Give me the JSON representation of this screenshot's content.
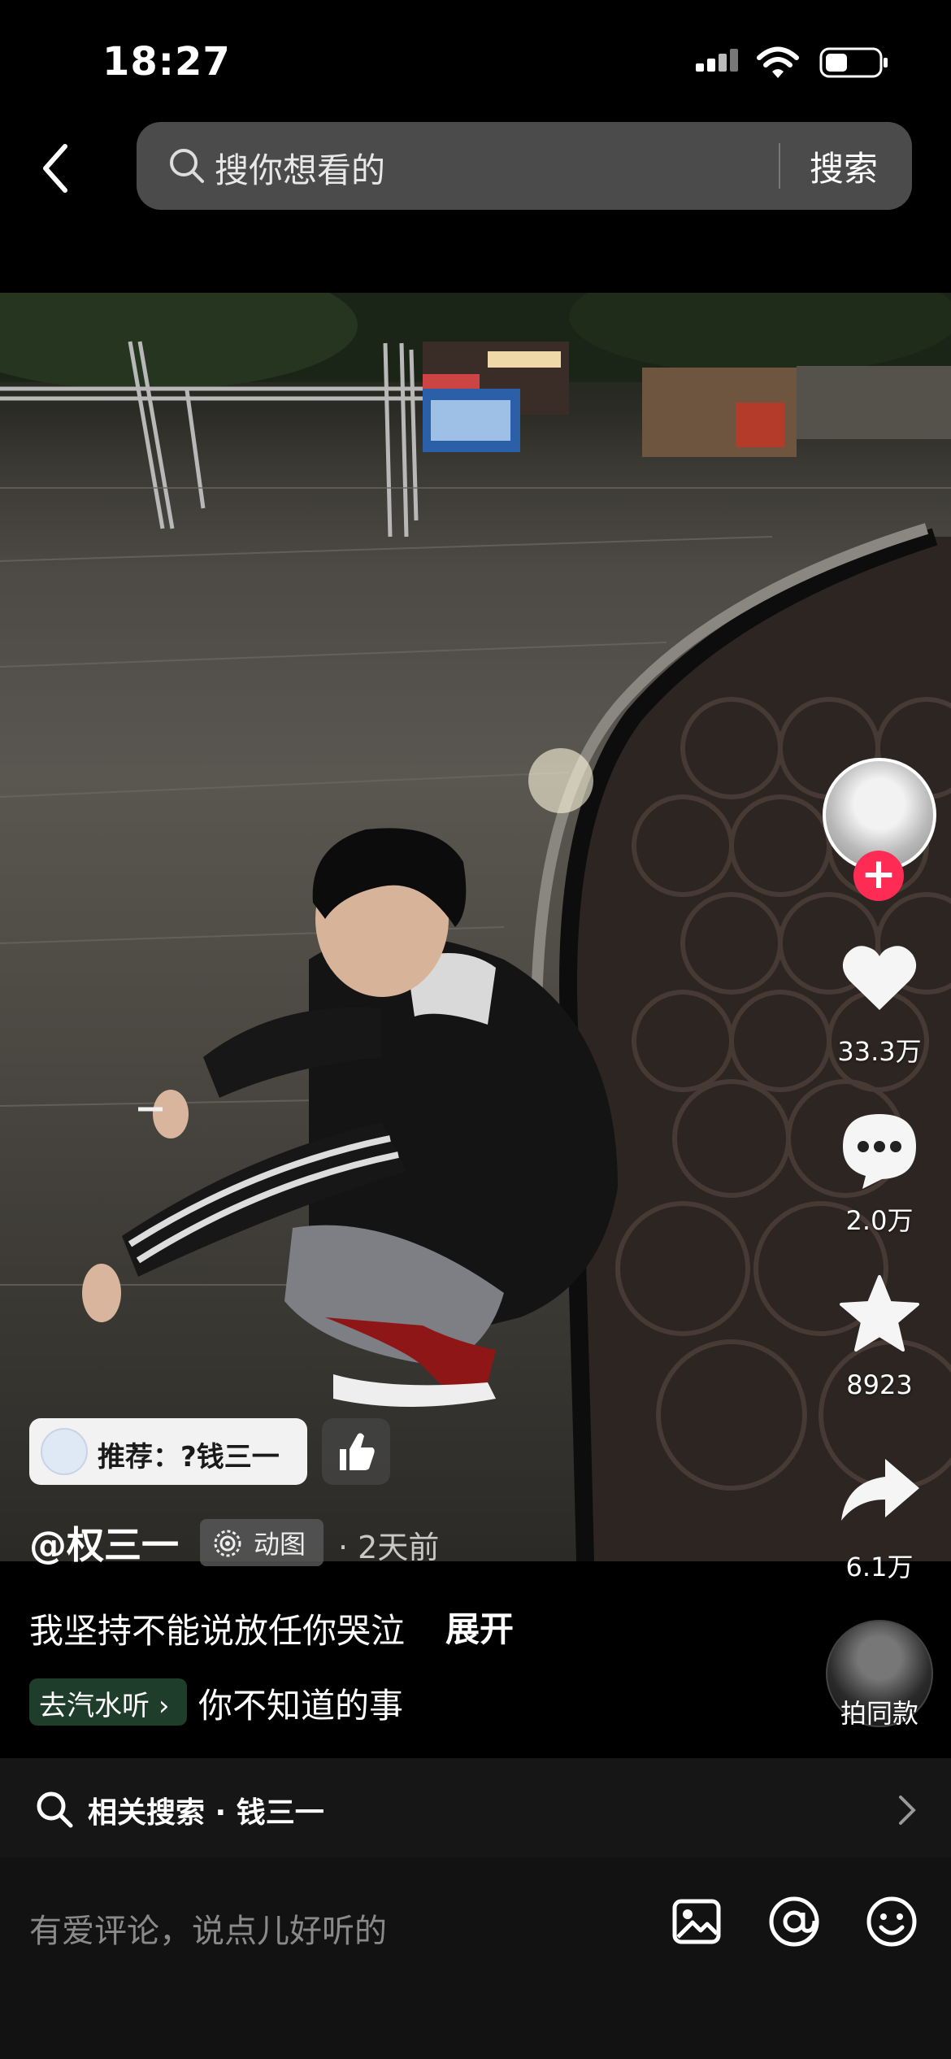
{
  "status_bar": {
    "time": "18:27"
  },
  "search": {
    "placeholder": "搜你想看的",
    "button_label": "搜索"
  },
  "actions": {
    "likes": "33.3万",
    "comments": "2.0万",
    "favorites": "8923",
    "shares": "6.1万",
    "same_style_label": "拍同款"
  },
  "recommend": {
    "label": "推荐：?钱三一"
  },
  "post": {
    "author": "@权三一",
    "tag": "动图",
    "time": "· 2天前",
    "caption": "我坚持不能说放任你哭泣",
    "expand_label": "展开"
  },
  "music": {
    "chip_label": "去汽水听",
    "title": "你不知道的事"
  },
  "related_search": {
    "text": "相关搜索 · 钱三一"
  },
  "comment": {
    "placeholder": "有爱评论，说点儿好听的"
  },
  "icons": {
    "back": "chevron-left-icon",
    "search": "search-icon",
    "like": "heart-icon",
    "comment": "comment-bubble-icon",
    "favorite": "star-icon",
    "share": "share-arrow-icon",
    "follow": "plus-icon",
    "image": "image-icon",
    "mention": "at-icon",
    "emoji": "emoji-icon",
    "chevron_right": "chevron-right-icon",
    "animation": "animation-icon",
    "thumb": "thumbs-up-icon"
  },
  "colors": {
    "follow_accent": "#fe2c55",
    "background": "#000000"
  }
}
